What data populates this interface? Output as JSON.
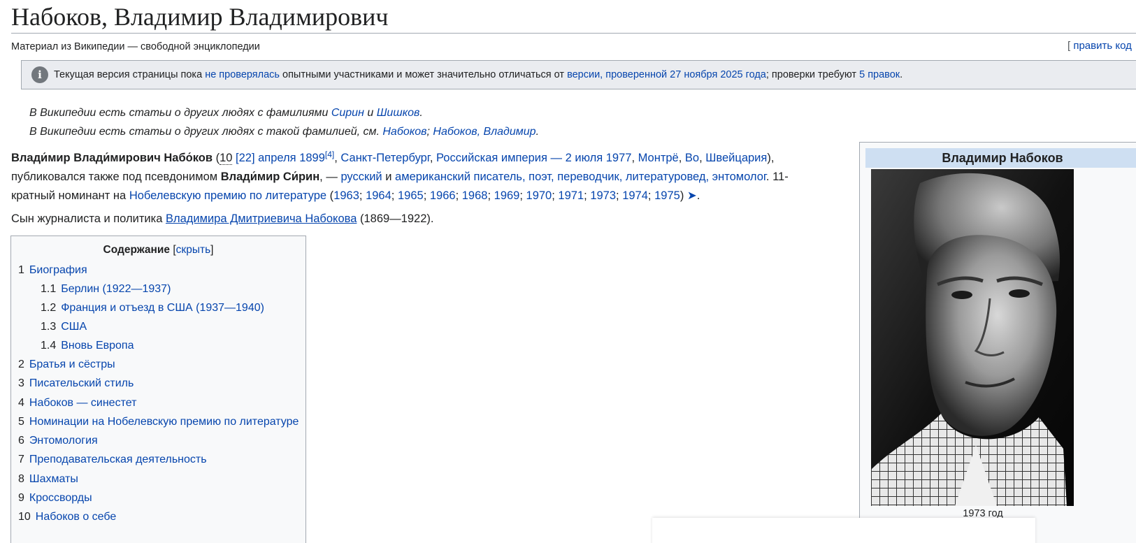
{
  "page": {
    "title": "Набоков, Владимир Владимирович",
    "tagline": "Материал из Википедии — свободной энциклопедии",
    "edit_code": {
      "open": "[ ",
      "link": "править код"
    }
  },
  "notice": {
    "icon": "info-icon",
    "t1": "Текущая версия страницы пока ",
    "l1": "не проверялась",
    "t2": " опытными участниками и может значительно отличаться от ",
    "l2": "версии, проверенной 27 ноября 2025 года",
    "t3": "; проверки требуют ",
    "l3": "5 правок",
    "t4": "."
  },
  "hatnotes": {
    "h1": {
      "t1": "В Википедии есть статьи о других людях с фамилиями ",
      "l1": "Сирин",
      "t2": " и ",
      "l2": "Шишков",
      "t3": "."
    },
    "h2": {
      "t1": "В Википедии есть статьи о других людях с такой фамилией, см. ",
      "l1": "Набоков",
      "t2": "; ",
      "l2": "Набоков, Владимир",
      "t3": "."
    }
  },
  "lead": {
    "name": "Влади́мир Влади́мирович Набо́ков",
    "p1": " (",
    "d10": "10",
    "d22": " [22] апреля 1899",
    "ref4": "[4]",
    "c1": ", ",
    "spb": "Санкт-Петербург",
    "c2": ", ",
    "empire": "Российская империя",
    "dash": " — ",
    "death": "2 июля 1977",
    "c3": ", ",
    "montreux": "Монтрё",
    "c4": ", ",
    "vaud": "Во",
    "c5": ", ",
    "swiss": "Швейцария",
    "p2": "),",
    "pseud_pre": "публиковался также под псевдонимом ",
    "pseud": "Влади́мир Си́рин",
    "after_pseud": ", — ",
    "russian": "русский",
    "and": " и ",
    "american": "американский",
    "sp": " ",
    "writer": "писатель",
    "c6": ", ",
    "poet": "поэт",
    "c7": ", ",
    "translator": "переводчик",
    "c8": ", ",
    "critic": "литературовед",
    "c9": ", ",
    "ento": "энтомолог",
    "nom_pre": ". 11-кратный номинант на ",
    "nobel": "Нобелевскую премию по литературе",
    "open": " (",
    "years": [
      "1963",
      "1964",
      "1965",
      "1966",
      "1968",
      "1969",
      "1970",
      "1971",
      "1973",
      "1974",
      "1975"
    ],
    "close": ") ",
    "arrow": "➤",
    "end": "."
  },
  "para2": {
    "t1": "Сын журналиста и политика ",
    "link": "Владимира Дмитриевича Набокова",
    "t2": " (1869—1922)."
  },
  "toc": {
    "heading": "Содержание",
    "open": " [",
    "hide": "скрыть",
    "close": "]",
    "items": [
      {
        "num": "1",
        "label": "Биография"
      },
      {
        "num": "1.1",
        "label": "Берлин (1922—1937)"
      },
      {
        "num": "1.2",
        "label": "Франция и отъезд в США (1937—1940)"
      },
      {
        "num": "1.3",
        "label": "США"
      },
      {
        "num": "1.4",
        "label": "Вновь Европа"
      },
      {
        "num": "2",
        "label": "Братья и сёстры"
      },
      {
        "num": "3",
        "label": "Писательский стиль"
      },
      {
        "num": "4",
        "label": "Набоков — синестет"
      },
      {
        "num": "5",
        "label": "Номинации на Нобелевскую премию по литературе"
      },
      {
        "num": "6",
        "label": "Энтомология"
      },
      {
        "num": "7",
        "label": "Преподавательская деятельность"
      },
      {
        "num": "8",
        "label": "Шахматы"
      },
      {
        "num": "9",
        "label": "Кроссворды"
      },
      {
        "num": "10",
        "label": "Набоков о себе"
      }
    ]
  },
  "infobox": {
    "title": "Владимир Набоков",
    "caption": "1973 год"
  }
}
